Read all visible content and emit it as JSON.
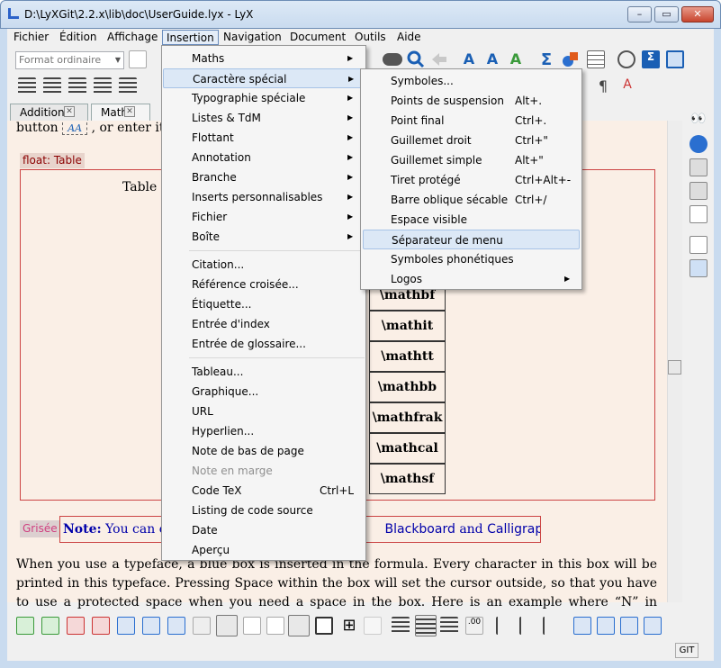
{
  "window": {
    "title": "D:\\LyXGit\\2.2.x\\lib\\doc\\UserGuide.lyx - LyX",
    "minimize": "–",
    "maximize": "▭",
    "close": "✕"
  },
  "menubar": [
    "Fichier",
    "Édition",
    "Affichage",
    "Insertion",
    "Navigation",
    "Document",
    "Outils",
    "Aide"
  ],
  "toolbar": {
    "paragraph_style": "Format ordinaire"
  },
  "tabs": [
    {
      "label": "Additional",
      "close": "✕"
    },
    {
      "label": "Math",
      "close": "✕"
    }
  ],
  "document": {
    "top_text": "button",
    "top_text_after": ", or enter its c",
    "float_label": "float: Table",
    "table_caption": "Table 5",
    "table_cells": [
      "\\mathbf",
      "\\mathit",
      "\\mathtt",
      "\\mathbb",
      "\\mathfrak",
      "\\mathcal",
      "\\mathsf"
    ],
    "grise_label": "Grisée",
    "note_bold": "Note:",
    "note_text": "You can onl",
    "note_fonts": "Blackboard",
    "note_and": "and",
    "note_calli": "Calligraphic",
    "note_end": ".",
    "paragraph": "When you use a typeface, a blue box is inserted in the formula. Every character in this box will be printed in this typeface. Pressing Space within the box will set the cursor outside, so that you have to use a protected space when you need a space in the box. Here is an example where “N” in Blackboard denotes the set of numbers:"
  },
  "insertion_menu": [
    {
      "label": "Maths",
      "submenu": true
    },
    {
      "label": "Caractère spécial",
      "submenu": true,
      "highlighted": true
    },
    {
      "label": "Typographie spéciale",
      "submenu": true
    },
    {
      "label": "Listes & TdM",
      "submenu": true
    },
    {
      "label": "Flottant",
      "submenu": true
    },
    {
      "label": "Annotation",
      "submenu": true
    },
    {
      "label": "Branche",
      "submenu": true
    },
    {
      "label": "Inserts personnalisables",
      "submenu": true
    },
    {
      "label": "Fichier",
      "submenu": true
    },
    {
      "label": "Boîte",
      "submenu": true
    },
    {
      "label": "Citation..."
    },
    {
      "label": "Référence croisée..."
    },
    {
      "label": "Étiquette..."
    },
    {
      "label": "Entrée d'index"
    },
    {
      "label": "Entrée de glossaire..."
    },
    {
      "label": "Tableau..."
    },
    {
      "label": "Graphique..."
    },
    {
      "label": "URL"
    },
    {
      "label": "Hyperlien..."
    },
    {
      "label": "Note de bas de page"
    },
    {
      "label": "Note en marge",
      "disabled": true
    },
    {
      "label": "Code TeX",
      "shortcut": "Ctrl+L"
    },
    {
      "label": "Listing de code source"
    },
    {
      "label": "Date"
    },
    {
      "label": "Aperçu"
    }
  ],
  "special_char_menu": [
    {
      "label": "Symboles..."
    },
    {
      "label": "Points de suspension",
      "shortcut": "Alt+."
    },
    {
      "label": "Point final",
      "shortcut": "Ctrl+."
    },
    {
      "label": "Guillemet droit",
      "shortcut": "Ctrl+\""
    },
    {
      "label": "Guillemet simple",
      "shortcut": "Alt+\""
    },
    {
      "label": "Tiret protégé",
      "shortcut": "Ctrl+Alt+-"
    },
    {
      "label": "Barre oblique sécable",
      "shortcut": "Ctrl+/"
    },
    {
      "label": "Espace visible"
    },
    {
      "label": "Séparateur de menu",
      "highlighted": true
    },
    {
      "label": "Symboles phonétiques"
    },
    {
      "label": "Logos",
      "submenu": true
    }
  ],
  "submenu_arrow": "▶",
  "statusbar": {
    "git": "GIT"
  },
  "colors": {
    "accent": "#3a6fc4",
    "doc_bg": "#faefe6",
    "frame": "#c9dbef",
    "red": "#cc3333"
  }
}
